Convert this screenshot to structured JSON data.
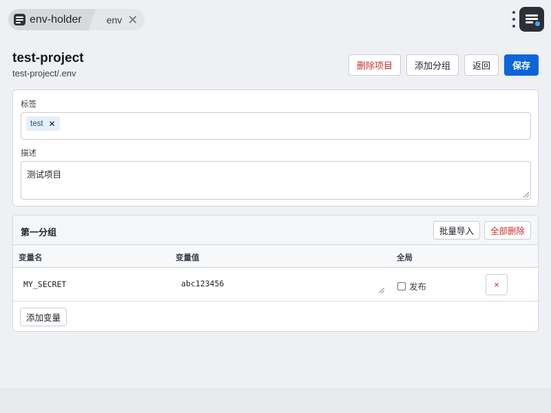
{
  "tabs": {
    "app_title": "env-holder",
    "env_tab": "env"
  },
  "header": {
    "title": "test-project",
    "path": "test-project/.env",
    "delete_project": "删除项目",
    "add_group": "添加分组",
    "back": "返回",
    "save": "保存"
  },
  "meta": {
    "tags_label": "标签",
    "tags": [
      "test"
    ],
    "desc_label": "描述",
    "description": "测试项目"
  },
  "group": {
    "title": "第一分组",
    "bulk_import": "批量导入",
    "delete_all": "全部删除",
    "columns": [
      "变量名",
      "变量值",
      "全局"
    ],
    "rows": [
      {
        "name": "MY_SECRET",
        "value": "abc123456",
        "global_label": "发布",
        "global_checked": false,
        "delete": "×"
      }
    ],
    "add_variable": "添加变量"
  },
  "colors": {
    "primary": "#0b66d9",
    "danger": "#c9302c",
    "background": "#eef0f3"
  }
}
